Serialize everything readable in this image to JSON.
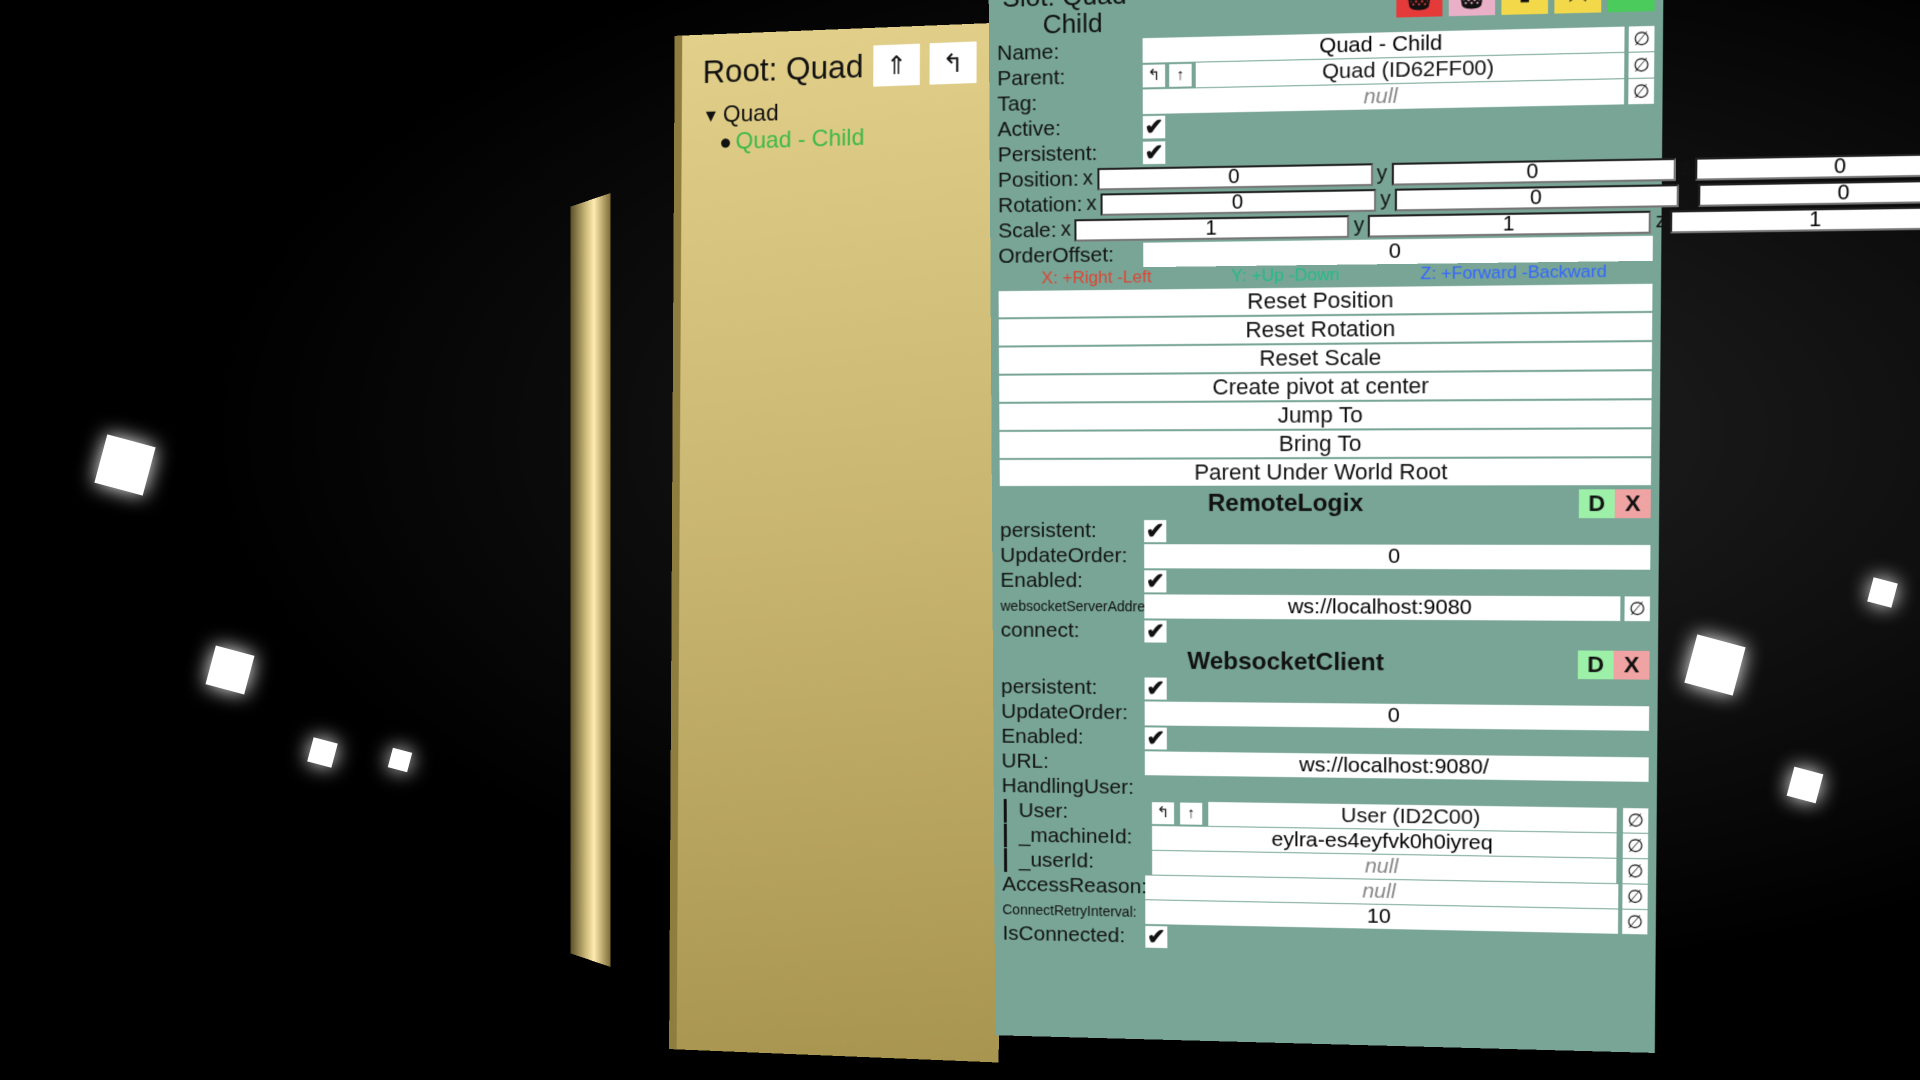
{
  "hierarchy": {
    "root_label": "Root: Quad",
    "nav_up_arrow": "⇑",
    "nav_out_arrow": "↰",
    "tree_root": "Quad",
    "tree_child": "Quad - Child"
  },
  "slot": {
    "title_prefix": "Slot:",
    "title_name": "Quad - Child",
    "icon_trash": "🗑",
    "icon_trash2": "🗑",
    "icon_up": "⬆",
    "icon_star": "★",
    "icon_plus": "▬"
  },
  "props": {
    "name_lbl": "Name:",
    "name_val": "Quad - Child",
    "parent_lbl": "Parent:",
    "parent_val": "Quad (ID62FF00)",
    "tag_lbl": "Tag:",
    "tag_val": "null",
    "active_lbl": "Active:",
    "persistent_lbl": "Persistent:",
    "position_lbl": "Position:",
    "pos_x": "0",
    "pos_y": "0",
    "pos_z": "0",
    "rotation_lbl": "Rotation:",
    "rot_x": "0",
    "rot_y": "0",
    "rot_z": "0",
    "scale_lbl": "Scale:",
    "scl_x": "1",
    "scl_y": "1",
    "scl_z": "1",
    "order_lbl": "OrderOffset:",
    "order_val": "0",
    "axis_x": "X: +Right -Left",
    "axis_y": "Y: +Up -Down",
    "axis_z": "Z: +Forward -Backward",
    "null_glyph": "∅",
    "check_glyph": "✔",
    "nav_in": "↰",
    "nav_up": "↑"
  },
  "actions": {
    "reset_pos": "Reset Position",
    "reset_rot": "Reset Rotation",
    "reset_scl": "Reset Scale",
    "pivot": "Create pivot at center",
    "jump": "Jump To",
    "bring": "Bring To",
    "parent_root": "Parent Under World Root"
  },
  "comp1": {
    "title": "RemoteLogix",
    "d": "D",
    "x": "X",
    "persistent_lbl": "persistent:",
    "updateorder_lbl": "UpdateOrder:",
    "updateorder_val": "0",
    "enabled_lbl": "Enabled:",
    "ws_addr_lbl": "websocketServerAddress:",
    "ws_addr_val": "ws://localhost:9080",
    "connect_lbl": "connect:"
  },
  "comp2": {
    "title": "WebsocketClient",
    "d": "D",
    "x": "X",
    "persistent_lbl": "persistent:",
    "updateorder_lbl": "UpdateOrder:",
    "updateorder_val": "0",
    "enabled_lbl": "Enabled:",
    "url_lbl": "URL:",
    "url_val": "ws://localhost:9080/",
    "handling_lbl": "HandlingUser:",
    "user_lbl": "User:",
    "user_val": "User  (ID2C00)",
    "mach_lbl": "_machineId:",
    "mach_val": "eylra-es4eyfvk0h0iyreq",
    "uid_lbl": "_userId:",
    "uid_val": "null",
    "access_lbl": "AccessReason:",
    "access_val": "null",
    "retry_lbl": "ConnectRetryInterval:",
    "retry_val": "10",
    "isconn_lbl": "IsConnected:"
  }
}
